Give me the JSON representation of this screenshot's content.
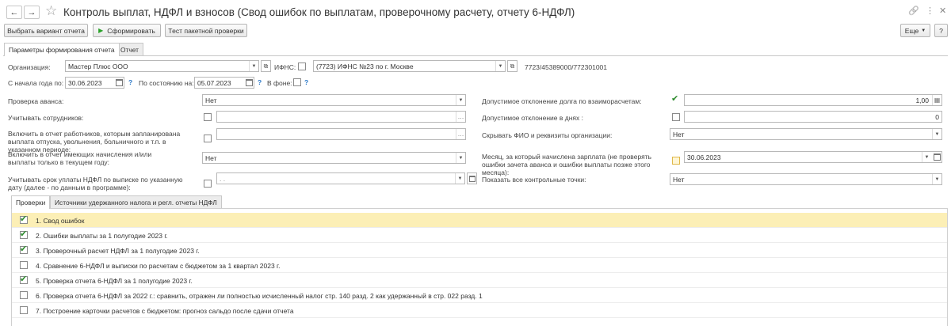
{
  "window": {
    "title": "Контроль выплат, НДФЛ и взносов (Свод ошибок по выплатам, проверочному расчету, отчету 6-НДФЛ)",
    "back_icon": "←",
    "forward_icon": "→",
    "star_icon": "☆",
    "link_icon": "🔗",
    "menu_icon": "⋮",
    "close_icon": "✕"
  },
  "toolbar": {
    "choose_variant": "Выбрать вариант отчета",
    "generate": "Сформировать",
    "batch_test": "Тест пакетной проверки",
    "more": "Еще",
    "help": "?"
  },
  "tabs": {
    "params": "Параметры формирования отчета",
    "report": "Отчет"
  },
  "form": {
    "org_label": "Организация:",
    "org_value": "Мастер Плюс ООО",
    "ifns_label": "ИФНС:",
    "ifns_value": "(7723) ИФНС №23 по г. Москве",
    "inn_kpp": "7723/45389000/772301001",
    "from_year_label": "С начала года по:",
    "from_year_value": "30.06.2023",
    "as_of_label": "По состоянию на:",
    "as_of_value": "05.07.2023",
    "background_label": "В фоне:",
    "advance_check_label": "Проверка аванса:",
    "advance_check_value": "Нет",
    "consider_employees_label": "Учитывать сотрудников:",
    "include_planned_label": "Включить  в отчет работников, которым запланирована выплата отпуска, увольнения, больничного и т.п. в указанном периоде:",
    "include_current_label": "Включить в отчет имеющих начисления и/или выплаты только в текущем году:",
    "include_current_value": "Нет",
    "consider_deadline_label": "Учитывать срок уплаты НДФЛ по выписке по указанную дату (далее - по данным в программе):",
    "consider_deadline_value": ". .",
    "allowed_debt_label": "Допустимое отклонение долга по взаиморасчетам:",
    "allowed_debt_value": "1,00",
    "allowed_days_label": "Допустимое отклонение в днях :",
    "allowed_days_value": "0",
    "hide_fio_label": "Скрывать ФИО и реквизиты организации:",
    "hide_fio_value": "Нет",
    "month_label": "Месяц, за который начислена зарплата (не проверять ошибки зачета аванса и ошибки выплаты позже этого месяца):",
    "month_value": "30.06.2023",
    "show_all_label": "Показать все контрольные точки:",
    "show_all_value": "Нет",
    "help_mark": "?"
  },
  "inner_tabs": {
    "checks": "Проверки",
    "sources": "Источники удержанного налога и регл. отчеты НДФЛ"
  },
  "checks": [
    {
      "label": "1. Свод ошибок",
      "checked": true,
      "selected": true
    },
    {
      "label": "2. Ошибки выплаты за 1 полугодие 2023 г.",
      "checked": true,
      "selected": false
    },
    {
      "label": "3. Проверочный расчет НДФЛ за 1 полугодие 2023 г.",
      "checked": true,
      "selected": false
    },
    {
      "label": "4. Сравнение 6-НДФЛ и выписки по расчетам с бюджетом за 1 квартал 2023 г.",
      "checked": false,
      "selected": false
    },
    {
      "label": "5. Проверка отчета 6-НДФЛ за 1 полугодие 2023 г.",
      "checked": true,
      "selected": false
    },
    {
      "label": "6. Проверка отчета 6-НДФЛ за 2022 г.: сравнить, отражен ли полностью исчисленный налог стр. 140 разд. 2 как удержанный в стр. 022 разд. 1",
      "checked": false,
      "selected": false
    },
    {
      "label": "7. Построение карточки расчетов с бюджетом: прогноз сальдо после сдачи отчета",
      "checked": false,
      "selected": false
    }
  ],
  "colors": {
    "accent_green": "#2aa22a",
    "check_green": "#2d8a2d",
    "selected_row": "#fcefb6",
    "help_blue": "#2e7ac9"
  }
}
